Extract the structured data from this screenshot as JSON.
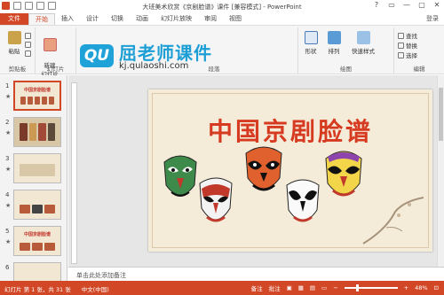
{
  "window": {
    "title": "大班美术欣赏《京剧脸谱》课件 [兼容模式] - PowerPoint",
    "controls": [
      "?",
      "▭",
      "—",
      "▢",
      "✕"
    ]
  },
  "tabs": [
    {
      "label": "文件"
    },
    {
      "label": "开始"
    },
    {
      "label": "插入"
    },
    {
      "label": "设计"
    },
    {
      "label": "切换"
    },
    {
      "label": "动画"
    },
    {
      "label": "幻灯片放映"
    },
    {
      "label": "审阅"
    },
    {
      "label": "视图"
    }
  ],
  "user": "登录",
  "ribbon": {
    "paste": "粘贴",
    "clipboard": "剪贴板",
    "new_slide": "新建\n幻灯片",
    "slides": "幻灯片",
    "paragraph": "段落",
    "shape": "形状",
    "arrange": "排列",
    "quick_styles": "快速样式",
    "drawing": "绘图",
    "find": "查找",
    "replace": "替换",
    "select": "选择",
    "editing": "编辑"
  },
  "watermark": {
    "badge": "QU",
    "name": "屈老师课件",
    "url": "kj.qulaoshi.com"
  },
  "thumbnails": [
    {
      "num": "1",
      "title": "中国京剧脸谱"
    },
    {
      "num": "2",
      "title": ""
    },
    {
      "num": "3",
      "title": ""
    },
    {
      "num": "4",
      "title": ""
    },
    {
      "num": "5",
      "title": "中国京剧脸谱"
    },
    {
      "num": "6",
      "title": ""
    }
  ],
  "slide": {
    "title": "中国京剧脸谱"
  },
  "notes_placeholder": "单击此处添加备注",
  "status": {
    "slide_info": "幻灯片 第 1 张，共 31 张",
    "language": "中文(中国)",
    "notes": "备注",
    "comments": "批注",
    "zoom": "48%",
    "zoom_fraction": 0.48
  },
  "colors": {
    "accent": "#d24726",
    "title_red": "#d63a20",
    "logo_blue": "#1fa2d8"
  }
}
